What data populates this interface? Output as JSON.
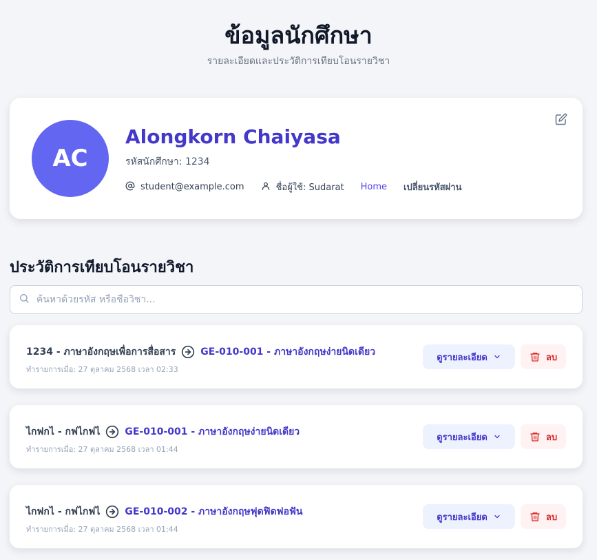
{
  "header": {
    "title": "ข้อมูลนักศึกษา",
    "subtitle": "รายละเอียดและประวัติการเทียบโอนรายวิชา"
  },
  "profile": {
    "initials": "AC",
    "name": "Alongkorn Chaiyasa",
    "student_id": "รหัสนักศึกษา: 1234",
    "email": "student@example.com",
    "username": "ชื่อผู้ใช้: Sudarat",
    "home_link": "Home",
    "change_password_link": "เปลี่ยนรหัสผ่าน",
    "avatar_color": "#6366f1",
    "name_color": "#4338ca",
    "icons": {
      "edit": "edit-icon",
      "email": "at-icon",
      "user": "user-icon"
    }
  },
  "history": {
    "title": "ประวัติการเทียบโอนรายวิชา",
    "search_placeholder": "ค้นหาด้วยรหัส หรือชื่อวิชา...",
    "records": [
      {
        "from": "1234 - ภาษาอังกฤษเพื่อการสื่อสาร",
        "to": "GE-010-001 - ภาษาอังกฤษง่ายนิดเดียว",
        "time": "ทำรายการเมื่อ: 27 ตุลาคม 2568 เวลา 02:33",
        "detail_label": "ดูรายละเอียด",
        "delete_label": "ลบ"
      },
      {
        "from": "ไกฟกไ - กฟไกฟไ",
        "to": "GE-010-001 - ภาษาอังกฤษง่ายนิดเดียว",
        "time": "ทำรายการเมื่อ: 27 ตุลาคม 2568 เวลา 01:44",
        "detail_label": "ดูรายละเอียด",
        "delete_label": "ลบ"
      },
      {
        "from": "ไกฟกไ - กฟไกฟไ",
        "to": "GE-010-002 - ภาษาอังกฤษฟุดฟิดฟอฟัน",
        "time": "ทำรายการเมื่อ: 27 ตุลาคม 2568 เวลา 01:44",
        "detail_label": "ดูรายละเอียด",
        "delete_label": "ลบ"
      }
    ]
  },
  "colors": {
    "accent": "#4f46e5",
    "danger": "#dc2626",
    "background": "#f3f5f9"
  }
}
